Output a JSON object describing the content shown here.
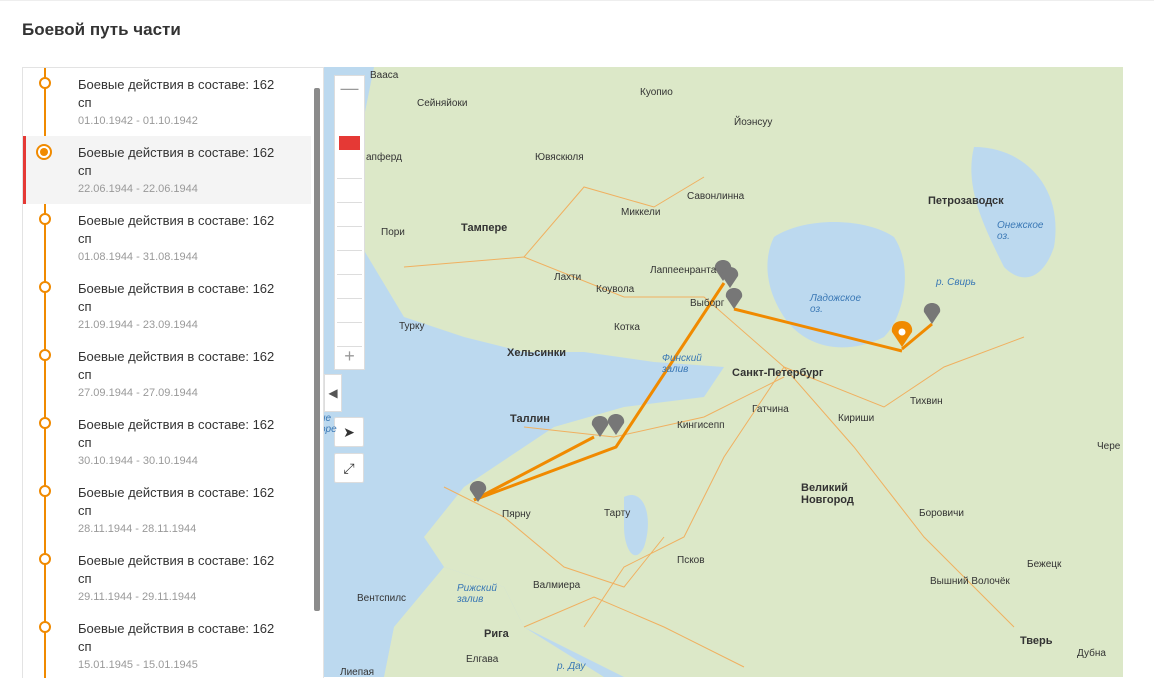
{
  "page": {
    "title": "Боевой путь части"
  },
  "timeline": {
    "items": [
      {
        "label": "Боевые действия в составе: 162 сп",
        "date": "01.10.1942 - 01.10.1942",
        "active": false
      },
      {
        "label": "Боевые действия в составе: 162 сп",
        "date": "22.06.1944 - 22.06.1944",
        "active": true
      },
      {
        "label": "Боевые действия в составе: 162 сп",
        "date": "01.08.1944 - 31.08.1944",
        "active": false
      },
      {
        "label": "Боевые действия в составе: 162 сп",
        "date": "21.09.1944 - 23.09.1944",
        "active": false
      },
      {
        "label": "Боевые действия в составе: 162 сп",
        "date": "27.09.1944 - 27.09.1944",
        "active": false
      },
      {
        "label": "Боевые действия в составе: 162 сп",
        "date": "30.10.1944 - 30.10.1944",
        "active": false
      },
      {
        "label": "Боевые действия в составе: 162 сп",
        "date": "28.11.1944 - 28.11.1944",
        "active": false
      },
      {
        "label": "Боевые действия в составе: 162 сп",
        "date": "29.11.1944 - 29.11.1944",
        "active": false
      },
      {
        "label": "Боевые действия в составе: 162 сп",
        "date": "15.01.1945 - 15.01.1945",
        "active": false
      }
    ]
  },
  "map": {
    "zoom_in": "+",
    "zoom_out": "—",
    "collapse_icon": "chevron-left-icon",
    "locate_icon": "navigation-arrow-icon",
    "fullscreen_icon": "expand-icon",
    "route_color": "#f08a00",
    "pin_color": "#777777",
    "active_pin_color": "#f08a00",
    "places": {
      "vaasa": "Вааса",
      "seinajoki": "Сейняйоки",
      "kuopio": "Куопио",
      "joensuu": "Йоэнсуу",
      "jyvaskyla": "Ювяскюля",
      "anferd": "апферд",
      "savonlinna": "Савонлинна",
      "mikkeli": "Миккели",
      "tampere": "Тампере",
      "pori": "Пори",
      "lahti": "Лахти",
      "kouvola": "Коувола",
      "lappeenranta": "Лаппеенранта",
      "vyborg": "Выборг",
      "kotka": "Котка",
      "turku": "Турку",
      "helsinki": "Хельсинки",
      "petrozavodsk": "Петрозаводск",
      "onega": "Онежское оз.",
      "svir": "р. Свирь",
      "ladoga": "Ладожское оз.",
      "finnish_gulf": "Финский залив",
      "spb": "Санкт-Петербург",
      "tallinn": "Таллин",
      "kingisepp": "Кингисепп",
      "gatchina": "Гатчина",
      "kirishi": "Кириши",
      "tikhvin": "Тихвин",
      "cherep": "Чере",
      "novgorod": "Великий Новгород",
      "parnu": "Пярну",
      "tartu": "Тарту",
      "borovichi": "Боровичи",
      "pskov": "Псков",
      "riga_gulf": "Рижский залив",
      "valmiera": "Валмиера",
      "ventspils": "Вентспилс",
      "riga": "Рига",
      "bezhetsk": "Бежецк",
      "volochek": "Вышний Волочёк",
      "tver": "Тверь",
      "elgava": "Елгава",
      "liepaja": "Лиепая",
      "dubna": "Дубна",
      "daugava": "р. Дау",
      "left_water": "ие оре"
    }
  }
}
